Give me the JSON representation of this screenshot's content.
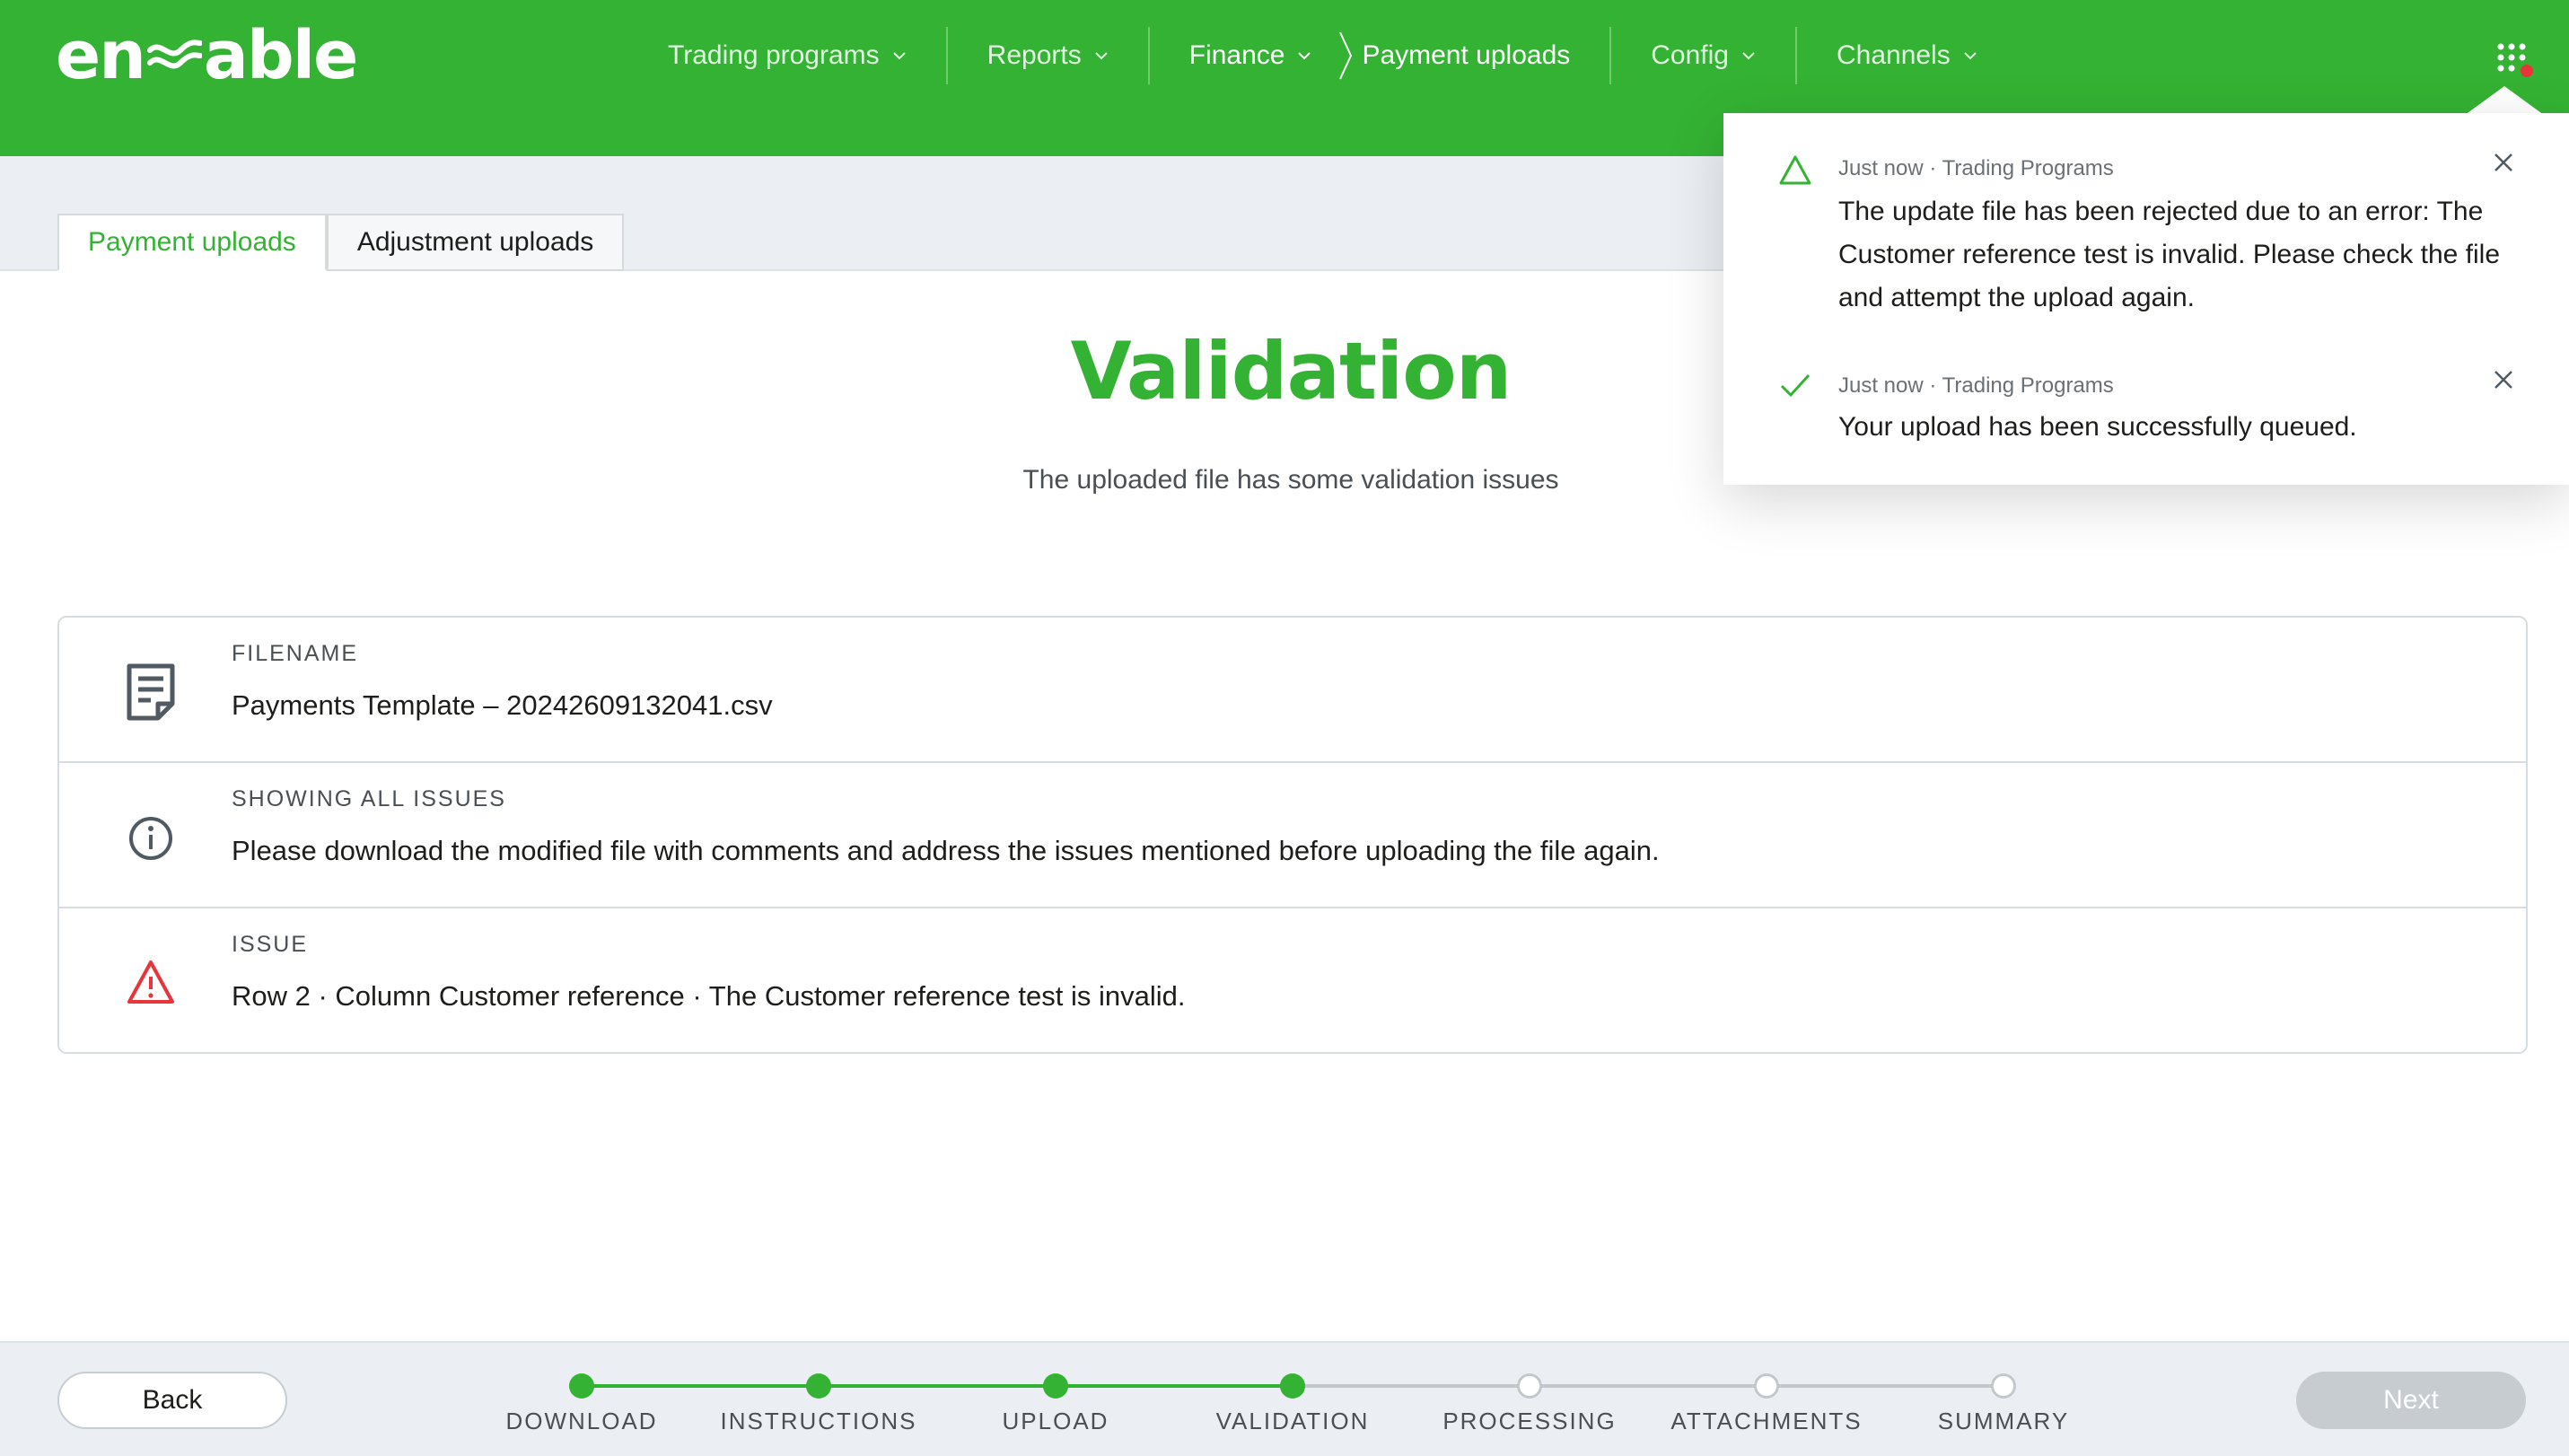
{
  "header": {
    "logo": "enable",
    "nav": [
      {
        "label": "Trading programs"
      },
      {
        "label": "Reports"
      },
      {
        "label": "Finance"
      },
      {
        "label": "Config"
      },
      {
        "label": "Channels"
      }
    ],
    "breadcrumb_current": "Payment uploads",
    "apps_icon": "grid-icon",
    "brand_color": "#34b233"
  },
  "tabs": [
    {
      "label": "Payment uploads",
      "active": true
    },
    {
      "label": "Adjustment uploads",
      "active": false
    }
  ],
  "main": {
    "title": "Validation",
    "subtitle": "The uploaded file has some validation issues"
  },
  "details": [
    {
      "label": "FILENAME",
      "value": "Payments Template – 20242609132041.csv",
      "icon": "file-icon"
    },
    {
      "label": "SHOWING ALL ISSUES",
      "value": "Please download the modified file with comments and address the issues mentioned before uploading the file again.",
      "icon": "info-icon"
    },
    {
      "label": "ISSUE",
      "value": "Row 2 · Column Customer reference · The Customer reference test is invalid.",
      "icon": "warning-icon"
    }
  ],
  "notifications": [
    {
      "meta": "Just now · Trading Programs",
      "text": "The update file has been rejected due to an error: The Customer reference test is invalid. Please check the file and attempt the upload again.",
      "icon": "alert-triangle-icon"
    },
    {
      "meta": "Just now · Trading Programs",
      "text": "Your upload has been successfully queued.",
      "icon": "check-icon"
    }
  ],
  "footer": {
    "back_label": "Back",
    "next_label": "Next",
    "steps": [
      {
        "label": "DOWNLOAD",
        "done": true
      },
      {
        "label": "INSTRUCTIONS",
        "done": true
      },
      {
        "label": "UPLOAD",
        "done": true
      },
      {
        "label": "VALIDATION",
        "done": true
      },
      {
        "label": "PROCESSING",
        "done": false
      },
      {
        "label": "ATTACHMENTS",
        "done": false
      },
      {
        "label": "SUMMARY",
        "done": false
      }
    ]
  }
}
